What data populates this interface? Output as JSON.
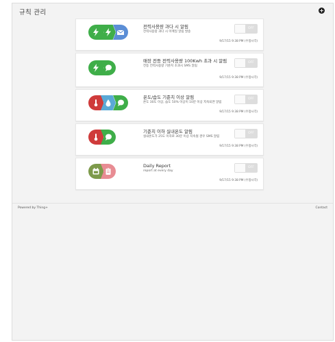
{
  "header": {
    "title": "규칙 관리",
    "add_icon": "plus-circle-icon"
  },
  "rules": [
    {
      "icons": [
        {
          "name": "lightning-icon",
          "color": "#3fae49"
        },
        {
          "name": "lightning-icon",
          "color": "#3fae49"
        },
        {
          "name": "envelope-icon",
          "color": "#5b8ed6"
        }
      ],
      "title": "전력사용량 과다 시 알림",
      "description": "전력사용량 과다 시 이메일 알림 발송",
      "toggle": "OFF",
      "updated": "9/17/15 9:38 PM (수정시각)"
    },
    {
      "icons": [
        {
          "name": "lightning-icon",
          "color": "#3fae49"
        },
        {
          "name": "speech-bubble-icon",
          "color": "#3fae49"
        }
      ],
      "title": "매장 전등 전력사용량 100Kwh 초과 시 알림",
      "description": "전등 전력사용량 기준치 초과시 SMS 알림",
      "toggle": "OFF",
      "updated": "9/17/15 9:38 PM (수정시각)"
    },
    {
      "icons": [
        {
          "name": "thermometer-icon",
          "color": "#cf3b3b"
        },
        {
          "name": "droplet-icon",
          "color": "#5aa9d6"
        },
        {
          "name": "speech-bubble-icon",
          "color": "#3fae49"
        }
      ],
      "title": "온도/습도 기준치 이상 알림",
      "description": "온도 30도 이상, 습도 50% 이상이 10분 이상 지속되면 알림",
      "toggle": "OFF",
      "updated": "9/17/15 9:38 PM (수정시각)"
    },
    {
      "icons": [
        {
          "name": "thermometer-icon",
          "color": "#cf3b3b"
        },
        {
          "name": "speech-bubble-icon",
          "color": "#3fae49"
        }
      ],
      "title": "기준치 이하 실내온도 알림",
      "description": "실내온도가 25도 이하로 30분 이상 지속될 경우 SMS 알림",
      "toggle": "OFF",
      "updated": "9/17/15 9:38 PM (수정시각)"
    },
    {
      "icons": [
        {
          "name": "calendar-icon",
          "color": "#7d9a4b"
        },
        {
          "name": "clipboard-icon",
          "color": "#e88c93"
        }
      ],
      "title": "Daily Report",
      "description": "report at every day",
      "toggle": "OFF",
      "updated": "9/17/15 9:38 PM (수정시각)"
    }
  ],
  "footer": {
    "powered_by": "Powered by Thing+",
    "contact": "Contact"
  }
}
